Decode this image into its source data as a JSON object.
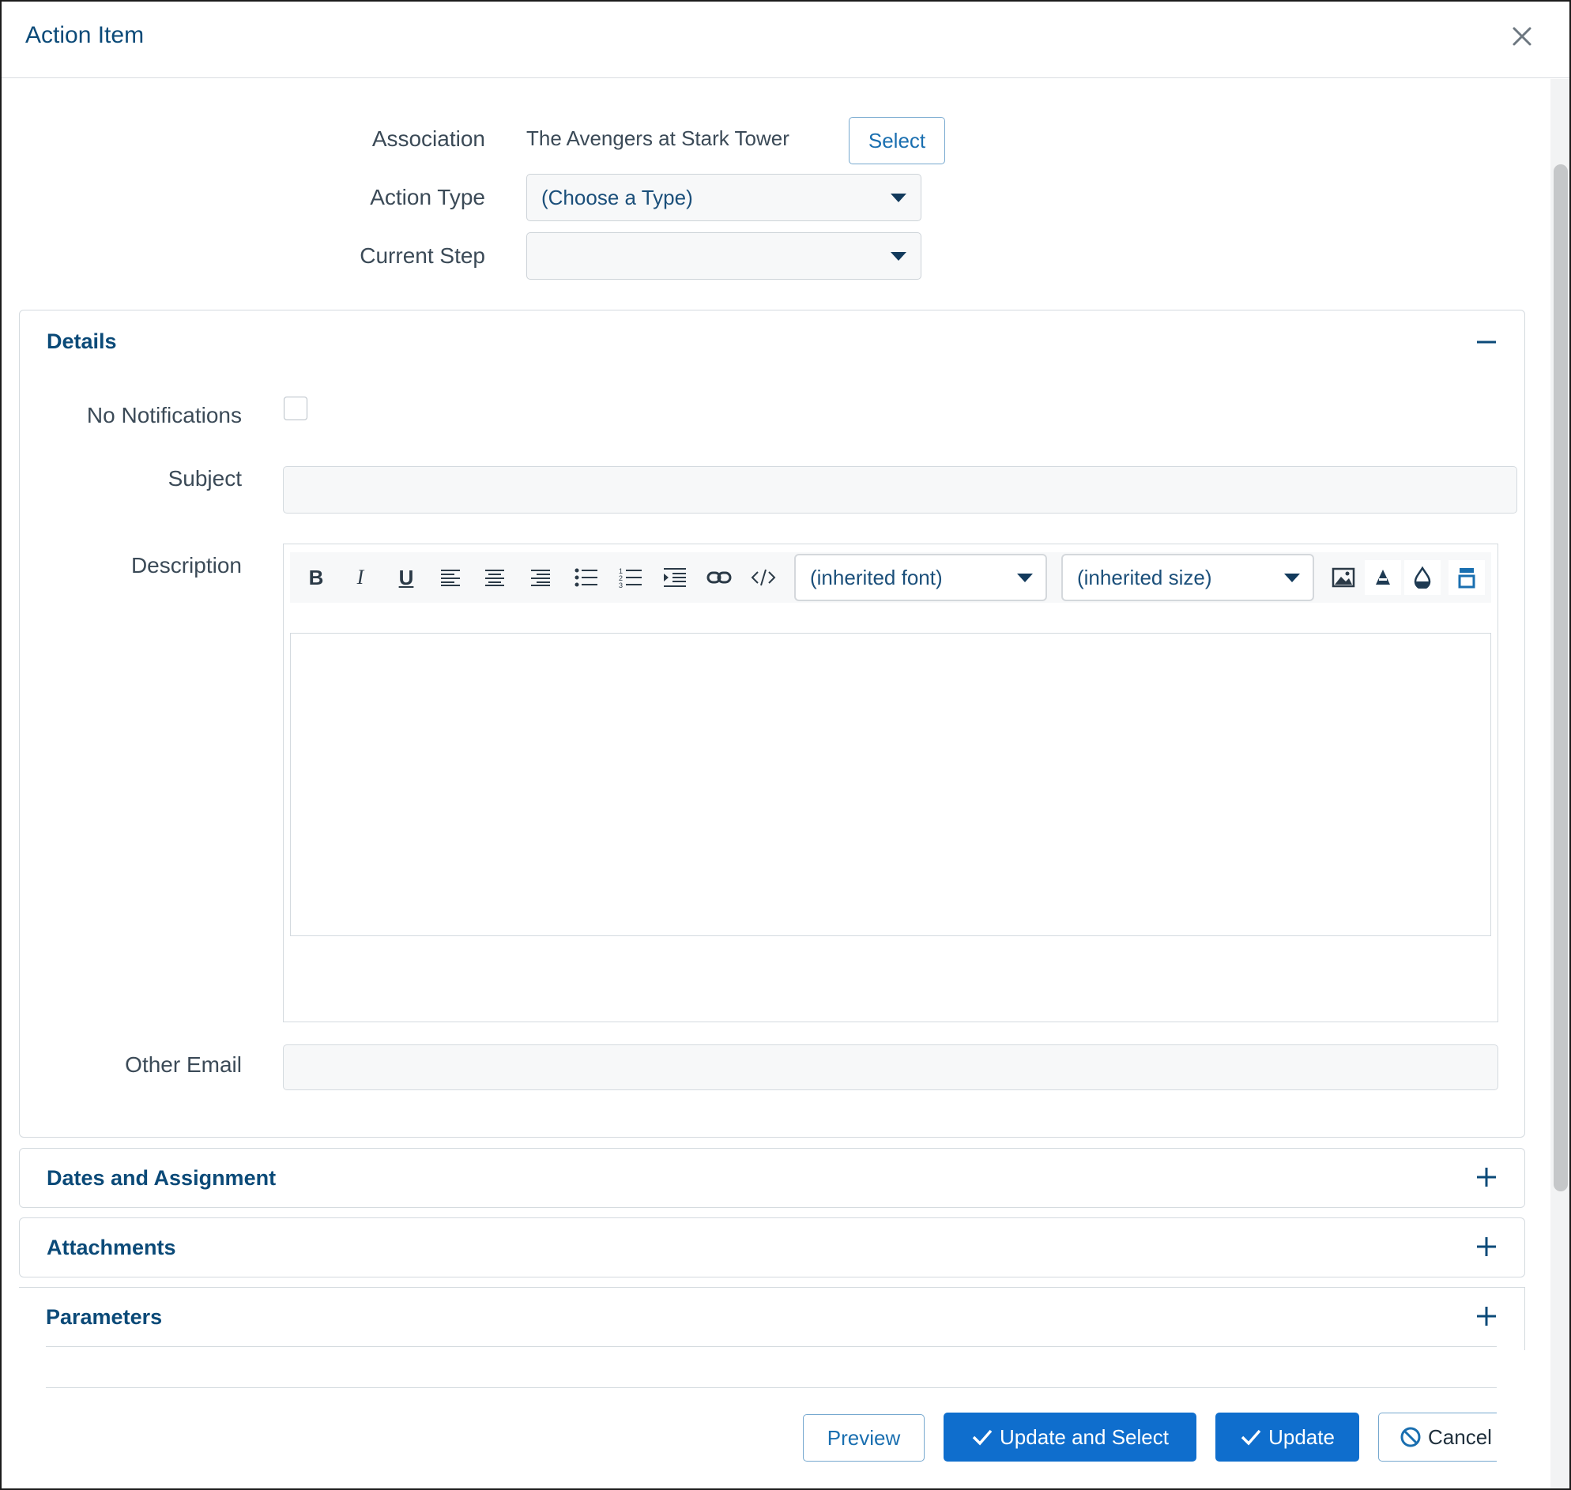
{
  "dialog": {
    "title": "Action Item"
  },
  "form": {
    "association_label": "Association",
    "association_value": "The Avengers at Stark Tower",
    "select_button": "Select",
    "action_type_label": "Action Type",
    "action_type_value": "(Choose a Type)",
    "current_step_label": "Current Step",
    "current_step_value": ""
  },
  "details": {
    "title": "Details",
    "no_notifications_label": "No Notifications",
    "no_notifications_checked": false,
    "subject_label": "Subject",
    "subject_value": "",
    "description_label": "Description",
    "font_select": "(inherited font)",
    "size_select": "(inherited size)",
    "toolbar_icons": [
      "bold-icon",
      "italic-icon",
      "underline-icon",
      "align-left-icon",
      "align-center-icon",
      "align-right-icon",
      "bullet-list-icon",
      "numbered-list-icon",
      "indent-icon",
      "link-icon",
      "code-icon",
      "image-icon",
      "text-color-icon",
      "fill-color-icon",
      "format-block-icon"
    ],
    "other_email_label": "Other Email",
    "other_email_value": ""
  },
  "sections": [
    {
      "title": "Dates and Assignment",
      "expanded": false
    },
    {
      "title": "Attachments",
      "expanded": false
    },
    {
      "title": "Parameters",
      "expanded": false
    }
  ],
  "footer": {
    "preview": "Preview",
    "update_and_select": "Update and Select",
    "update": "Update",
    "cancel": "Cancel"
  },
  "colors": {
    "accent": "#0f6ecd",
    "heading": "#0b4a78",
    "border": "#d4dadf"
  }
}
